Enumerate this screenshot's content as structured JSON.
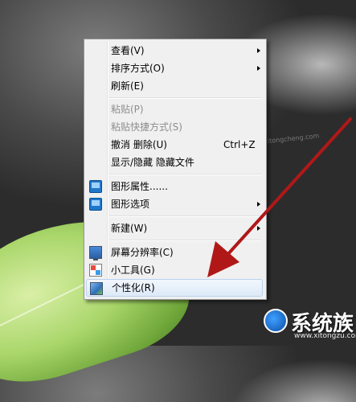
{
  "menu": {
    "items": [
      {
        "label": "查看(V)",
        "submenu": true
      },
      {
        "label": "排序方式(O)",
        "submenu": true
      },
      {
        "label": "刷新(E)"
      },
      {
        "label": "粘贴(P)",
        "disabled": true
      },
      {
        "label": "粘贴快捷方式(S)",
        "disabled": true
      },
      {
        "label": "撤消 删除(U)",
        "shortcut": "Ctrl+Z"
      },
      {
        "label": "显示/隐藏 隐藏文件"
      },
      {
        "label": "图形属性......",
        "icon": "graphics-properties-icon"
      },
      {
        "label": "图形选项",
        "icon": "graphics-options-icon",
        "submenu": true
      },
      {
        "label": "新建(W)",
        "submenu": true
      },
      {
        "label": "屏幕分辨率(C)",
        "icon": "monitor-icon"
      },
      {
        "label": "小工具(G)",
        "icon": "gadgets-icon"
      },
      {
        "label": "个性化(R)",
        "icon": "personalization-icon",
        "highlighted": true
      }
    ]
  },
  "watermark": {
    "brand": "系统族",
    "url": "www.xitongzu.com",
    "faint": "xitongcheng.com"
  },
  "colors": {
    "arrow": "#b01818",
    "highlight_border": "#b9d2ef"
  }
}
